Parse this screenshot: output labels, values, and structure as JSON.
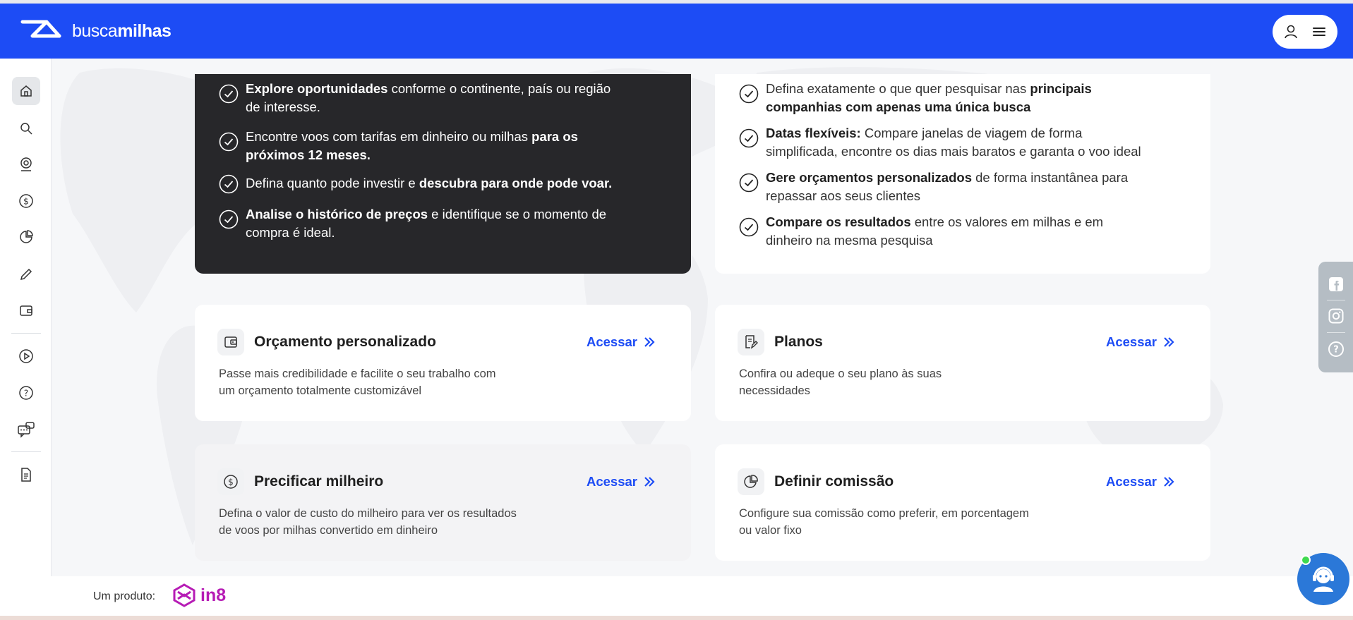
{
  "brand": {
    "name_light": "busca",
    "name_bold": "milhas"
  },
  "colors": {
    "primary": "#1d4cf5",
    "dark_card": "#27272a",
    "footer_brand": "#b61cb5",
    "chat": "#2b78d8"
  },
  "topbar": {
    "icons": [
      "user-icon",
      "menu-icon"
    ]
  },
  "sidebar": {
    "items": [
      "home-icon",
      "search-icon",
      "map-pin-icon",
      "dollar-icon",
      "chart-pie-icon",
      "pencil-icon",
      "wallet-icon",
      "play-icon",
      "help-icon",
      "chat-bubbles-icon",
      "document-icon"
    ],
    "active": "home-icon"
  },
  "dark_features": [
    {
      "bold1": "Explore oportunidades",
      "text1": " conforme o continente, país ou região",
      "line2": "de interesse."
    },
    {
      "text1": "Encontre voos com tarifas em dinheiro ou milhas ",
      "bold1": "para os",
      "bold2": "próximos 12 meses."
    },
    {
      "text1": "Defina quanto pode investir e ",
      "bold1": "descubra para onde pode voar."
    },
    {
      "bold1": "Analise o histórico de preços",
      "text1": " e identifique se o momento de",
      "line2": "compra é ideal."
    }
  ],
  "light_features": [
    {
      "text1": "Defina exatamente o que quer pesquisar nas ",
      "bold1": "principais",
      "bold2": "companhias com apenas uma única busca"
    },
    {
      "bold1": "Datas flexíveis:",
      "text1": " Compare janelas de viagem de forma",
      "line2": "simplificada, encontre os dias mais baratos e garanta o voo ideal"
    },
    {
      "bold1": "Gere orçamentos personalizados",
      "text1": " de forma instantânea para",
      "line2": "repassar aos seus clientes"
    },
    {
      "bold1": "Compare os resultados",
      "text1": " entre os valores em milhas e em",
      "line2": "dinheiro na mesma pesquisa"
    }
  ],
  "tiles": [
    {
      "icon": "wallet-icon",
      "title": "Orçamento personalizado",
      "link": "Acessar",
      "desc": [
        "Passe mais credibilidade e facilite o seu trabalho com",
        "um orçamento totalmente customizável"
      ]
    },
    {
      "icon": "plan-document-icon",
      "title": "Planos",
      "link": "Acessar",
      "desc": [
        "Confira ou adeque o seu plano às suas",
        "necessidades"
      ]
    },
    {
      "icon": "dollar-icon",
      "title": "Precificar milheiro",
      "link": "Acessar",
      "desc": [
        "Defina o valor de custo do milheiro para ver os resultados",
        "de voos por milhas convertido em dinheiro"
      ]
    },
    {
      "icon": "chart-pie-icon",
      "title": "Definir comissão",
      "link": "Acessar",
      "desc": [
        "Configure sua comissão como preferir, em porcentagem",
        "ou valor fixo"
      ]
    }
  ],
  "social": [
    "facebook-icon",
    "instagram-icon",
    "help-icon"
  ],
  "footer": {
    "label": "Um produto:",
    "brand": "in8"
  }
}
